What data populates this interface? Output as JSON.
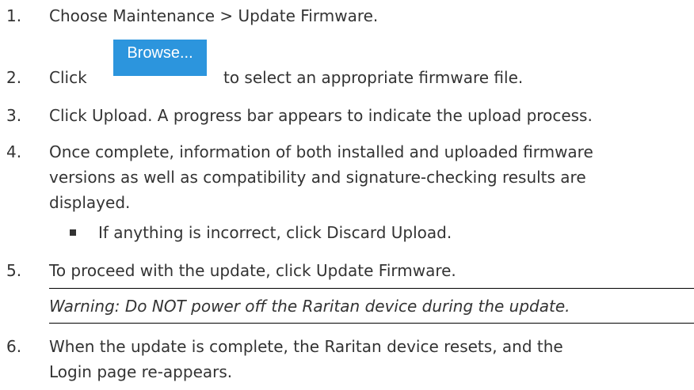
{
  "steps": [
    {
      "num": "1.",
      "lines": [
        "Choose Maintenance > Update Firmware."
      ]
    },
    {
      "num": "2.",
      "before": "Click",
      "after": "to select an appropriate firmware file."
    },
    {
      "num": "3.",
      "lines": [
        "Click Upload. A progress bar appears to indicate the upload process."
      ]
    },
    {
      "num": "4.",
      "lines": [
        "Once complete, information of both installed and uploaded firmware",
        "versions as well as compatibility and signature-checking results are",
        "displayed."
      ]
    },
    {
      "num": "5.",
      "lines": [
        "To proceed with the update, click Update Firmware."
      ]
    },
    {
      "num": "6.",
      "lines": [
        "When the update is complete, the Raritan device resets, and the",
        "Login page re-appears."
      ]
    }
  ],
  "browse_button": {
    "label": "Browse..."
  },
  "sub_bullet": "If anything is incorrect, click Discard Upload.",
  "warning": "Warning: Do NOT power off the Raritan device during the update."
}
